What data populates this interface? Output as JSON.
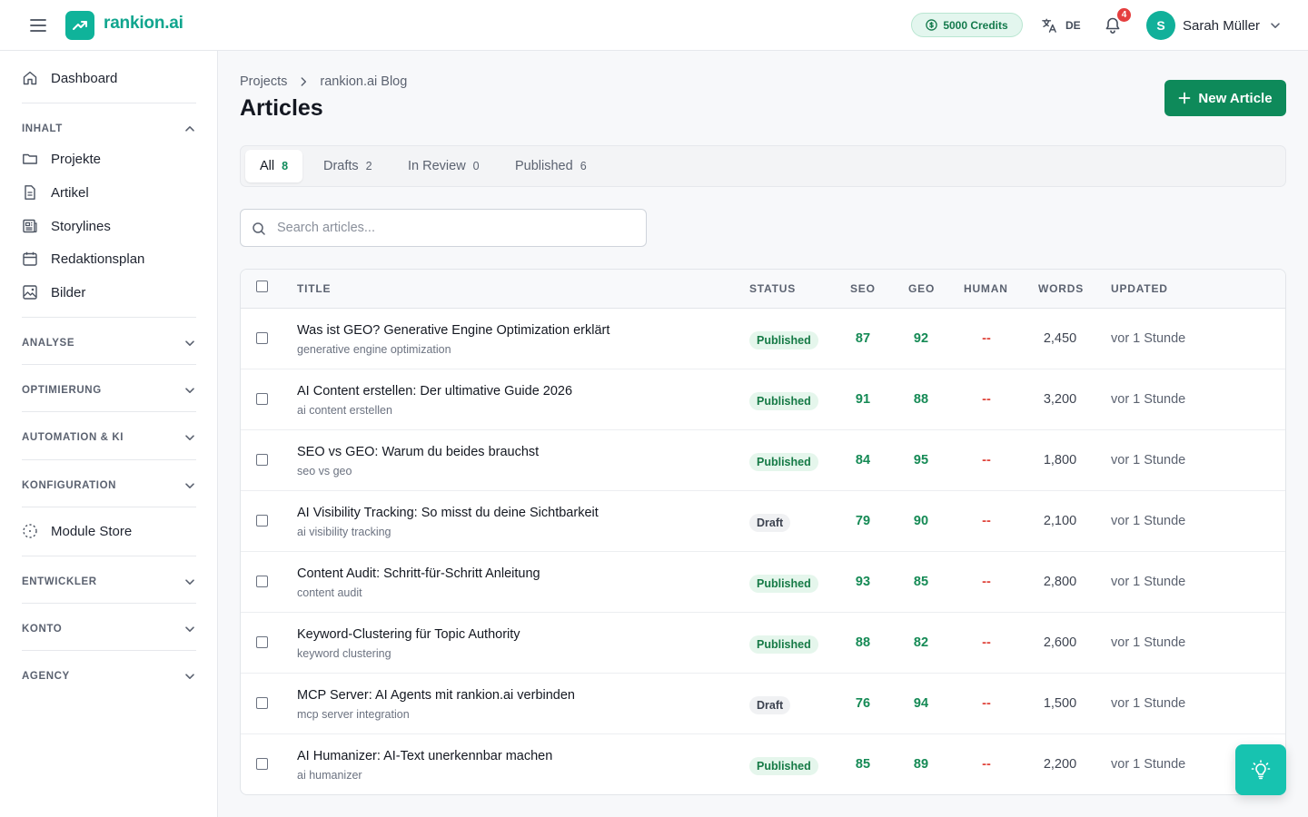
{
  "app": {
    "logo_text": "rankion.ai",
    "credits_label": "5000 Credits",
    "language": "DE",
    "notification_count": "4",
    "user_initial": "S",
    "user_name": "Sarah Müller",
    "accent_color": "#0e8a5a",
    "brand_color": "#10a58e"
  },
  "sidebar": {
    "dashboard": "Dashboard",
    "inhalt": {
      "label": "INHALT",
      "items": [
        "Projekte",
        "Artikel",
        "Storylines",
        "Redaktionsplan",
        "Bilder"
      ]
    },
    "analyse": "ANALYSE",
    "optimierung": "OPTIMIERUNG",
    "automation": "AUTOMATION & KI",
    "konfiguration": "KONFIGURATION",
    "module_store": "Module Store",
    "entwickler": "ENTWICKLER",
    "konto": "KONTO",
    "agency": "AGENCY"
  },
  "breadcrumb": [
    "Projects",
    "rankion.ai Blog"
  ],
  "page_title": "Articles",
  "new_article_label": "New Article",
  "tabs": [
    {
      "label": "All",
      "count": "8"
    },
    {
      "label": "Drafts",
      "count": "2"
    },
    {
      "label": "In Review",
      "count": "0"
    },
    {
      "label": "Published",
      "count": "6"
    }
  ],
  "search_placeholder": "Search articles...",
  "table": {
    "headers": {
      "title": "TITLE",
      "status": "STATUS",
      "seo": "SEO",
      "geo": "GEO",
      "human": "HUMAN",
      "words": "WORDS",
      "updated": "UPDATED"
    },
    "rows": [
      {
        "title": "Was ist GEO? Generative Engine Optimization erklärt",
        "keyword": "generative engine optimization",
        "status": "Published",
        "seo": "87",
        "geo": "92",
        "human": "--",
        "words": "2,450",
        "updated": "vor 1 Stunde"
      },
      {
        "title": "AI Content erstellen: Der ultimative Guide 2026",
        "keyword": "ai content erstellen",
        "status": "Published",
        "seo": "91",
        "geo": "88",
        "human": "--",
        "words": "3,200",
        "updated": "vor 1 Stunde"
      },
      {
        "title": "SEO vs GEO: Warum du beides brauchst",
        "keyword": "seo vs geo",
        "status": "Published",
        "seo": "84",
        "geo": "95",
        "human": "--",
        "words": "1,800",
        "updated": "vor 1 Stunde"
      },
      {
        "title": "AI Visibility Tracking: So misst du deine Sichtbarkeit",
        "keyword": "ai visibility tracking",
        "status": "Draft",
        "seo": "79",
        "geo": "90",
        "human": "--",
        "words": "2,100",
        "updated": "vor 1 Stunde"
      },
      {
        "title": "Content Audit: Schritt-für-Schritt Anleitung",
        "keyword": "content audit",
        "status": "Published",
        "seo": "93",
        "geo": "85",
        "human": "--",
        "words": "2,800",
        "updated": "vor 1 Stunde"
      },
      {
        "title": "Keyword-Clustering für Topic Authority",
        "keyword": "keyword clustering",
        "status": "Published",
        "seo": "88",
        "geo": "82",
        "human": "--",
        "words": "2,600",
        "updated": "vor 1 Stunde"
      },
      {
        "title": "MCP Server: AI Agents mit rankion.ai verbinden",
        "keyword": "mcp server integration",
        "status": "Draft",
        "seo": "76",
        "geo": "94",
        "human": "--",
        "words": "1,500",
        "updated": "vor 1 Stunde"
      },
      {
        "title": "AI Humanizer: AI-Text unerkennbar machen",
        "keyword": "ai humanizer",
        "status": "Published",
        "seo": "85",
        "geo": "89",
        "human": "--",
        "words": "2,200",
        "updated": "vor 1 Stunde"
      }
    ]
  }
}
